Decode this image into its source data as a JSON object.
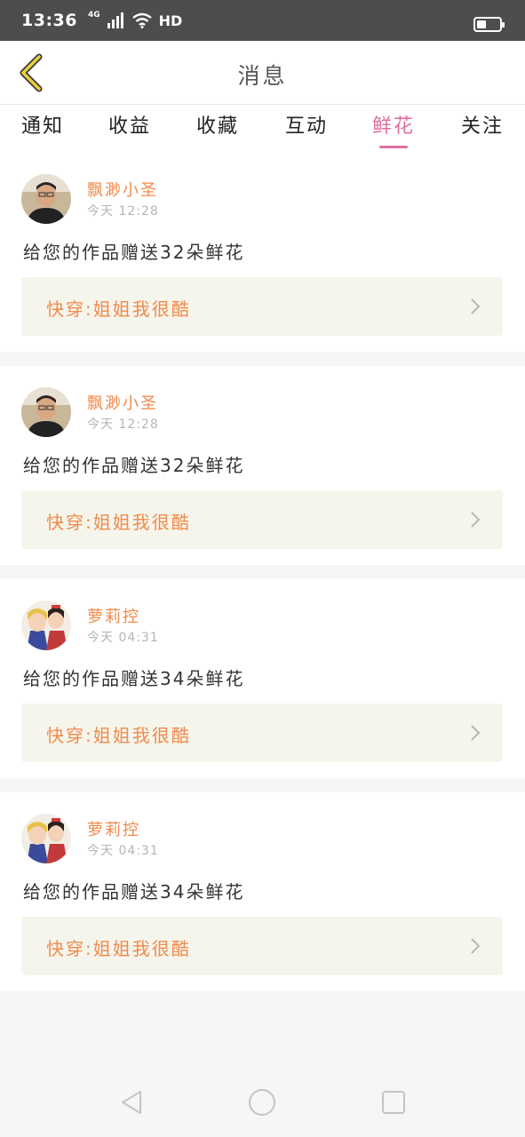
{
  "status_bar": {
    "time": "13:36",
    "network": "4G",
    "signal_label": "HD",
    "battery_level": 0.4
  },
  "header": {
    "title": "消息"
  },
  "tabs": [
    {
      "label": "通知"
    },
    {
      "label": "收益"
    },
    {
      "label": "收藏"
    },
    {
      "label": "互动"
    },
    {
      "label": "鲜花",
      "active": true
    },
    {
      "label": "关注"
    }
  ],
  "messages": [
    {
      "username": "飘渺小圣",
      "time": "今天 12:28",
      "text": "给您的作品赠送32朵鲜花",
      "work": "快穿:姐姐我很酷",
      "avatar": "man-photo"
    },
    {
      "username": "飘渺小圣",
      "time": "今天 12:28",
      "text": "给您的作品赠送32朵鲜花",
      "work": "快穿:姐姐我很酷",
      "avatar": "man-photo"
    },
    {
      "username": "萝莉控",
      "time": "今天 04:31",
      "text": "给您的作品赠送34朵鲜花",
      "work": "快穿:姐姐我很酷",
      "avatar": "anime-girls"
    },
    {
      "username": "萝莉控",
      "time": "今天 04:31",
      "text": "给您的作品赠送34朵鲜花",
      "work": "快穿:姐姐我很酷",
      "avatar": "anime-girls"
    }
  ],
  "colors": {
    "accent": "#e06fa0",
    "orange": "#f08a4b",
    "status_bar": "#4d4d4d",
    "link_bg": "#f6f5ec"
  },
  "icons": {
    "back": "back-chevron-icon",
    "nav": [
      "back-triangle-icon",
      "home-circle-icon",
      "recents-square-icon"
    ]
  }
}
